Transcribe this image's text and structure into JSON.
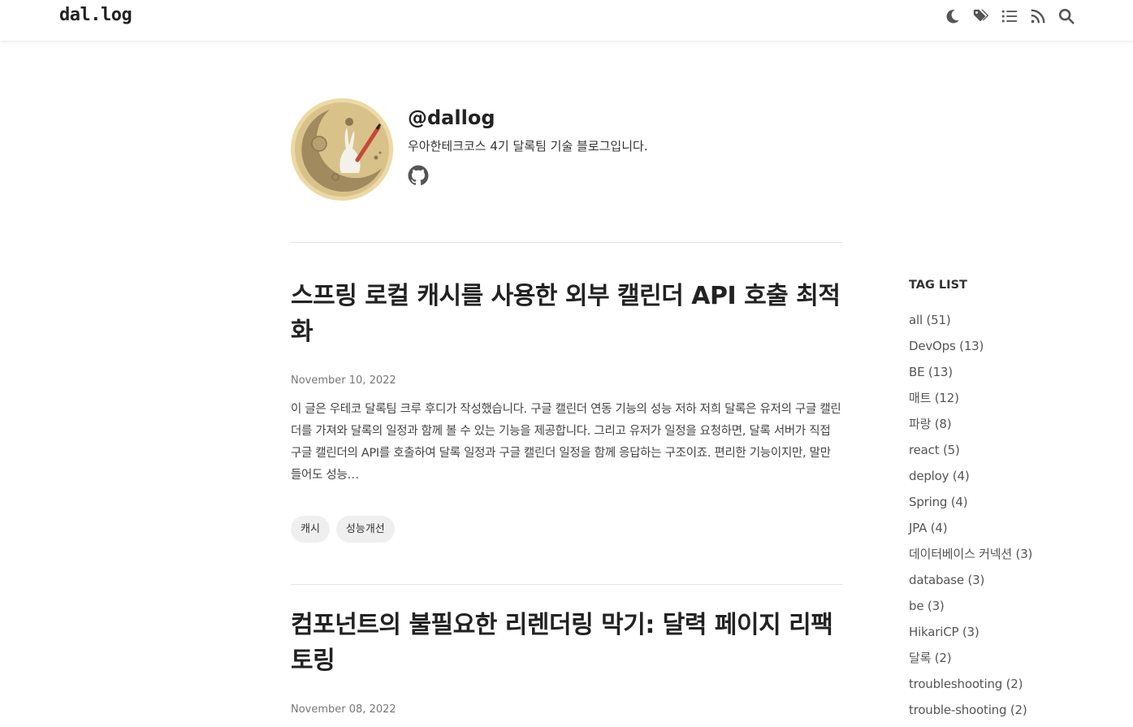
{
  "header": {
    "logo": "dal.log",
    "icons": [
      "moon-icon",
      "tags-icon",
      "list-icon",
      "rss-icon",
      "search-icon"
    ]
  },
  "bio": {
    "name": "@dallog",
    "description": "우아한테크코스 4기 달록팀 기술 블로그입니다."
  },
  "posts": [
    {
      "title": "스프링 로컬 캐시를 사용한 외부 캘린더 API 호출 최적화",
      "date": "November 10, 2022",
      "excerpt": "이 글은 우테코 달록팀 크루 후디가 작성했습니다. 구글 캘린더 연동 기능의 성능 저하 저희 달록은 유저의 구글 캘린더를 가져와 달록의 일정과 함께 볼 수 있는 기능을 제공합니다. 그리고 유저가 일정을 요청하면, 달록 서버가 직접 구글 캘린더의 API를 호출하여 달록 일정과 구글 캘린더 일정을 함께 응답하는 구조이죠. 편리한 기능이지만, 말만 들어도 성능…",
      "tags": [
        "캐시",
        "성능개선"
      ]
    },
    {
      "title": "컴포넌트의 불필요한 리렌더링 막기: 달력 페이지 리팩토링",
      "date": "November 08, 2022"
    }
  ],
  "tag_list": {
    "title": "TAG LIST",
    "items": [
      "all (51)",
      "DevOps (13)",
      "BE (13)",
      "매트 (12)",
      "파랑 (8)",
      "react (5)",
      "deploy (4)",
      "Spring (4)",
      "JPA (4)",
      "데이터베이스 커넥션 (3)",
      "database (3)",
      "be (3)",
      "HikariCP (3)",
      "달록 (2)",
      "troubleshooting (2)",
      "trouble-shooting (2)"
    ]
  },
  "colors": {
    "text": "#222222",
    "muted": "#777777",
    "chip": "#efefef",
    "divider": "#e4e4e4",
    "avatar_bg": "#ecd9a5"
  }
}
